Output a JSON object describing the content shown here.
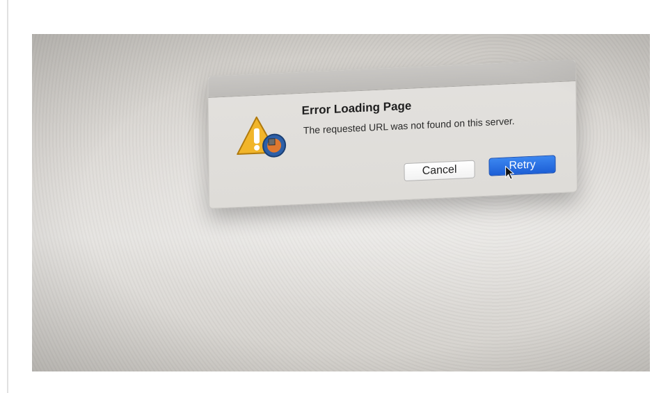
{
  "dialog": {
    "title": "Error Loading Page",
    "message": "The requested URL was not found on this server.",
    "buttons": {
      "cancel_label": "Cancel",
      "retry_label": "Retry"
    }
  },
  "icons": {
    "alert": "warning-triangle-icon",
    "badge": "app-badge-icon",
    "cursor": "mouse-pointer-icon"
  },
  "colors": {
    "primary_button": "#1d5fd6",
    "warning": "#f0b429"
  }
}
